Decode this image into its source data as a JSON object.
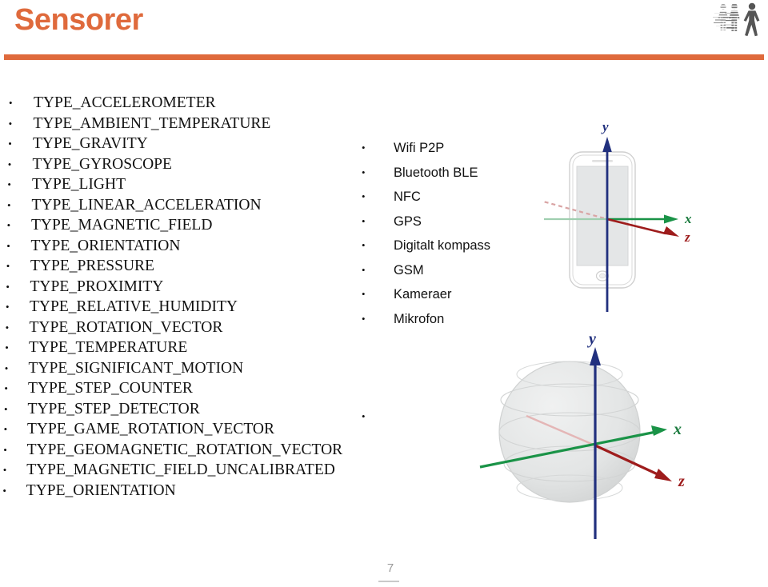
{
  "header": {
    "title": "Sensorer",
    "accent_color": "#DF6A3C",
    "rule_color": "#DF6A3C",
    "logo_name": "walking-people-logo"
  },
  "sensor_types": [
    "TYPE_ACCELEROMETER",
    "TYPE_AMBIENT_TEMPERATURE",
    "TYPE_GRAVITY",
    "TYPE_GYROSCOPE",
    "TYPE_LIGHT",
    "TYPE_LINEAR_ACCELERATION",
    "TYPE_MAGNETIC_FIELD",
    "TYPE_ORIENTATION",
    "TYPE_PRESSURE",
    "TYPE_PROXIMITY",
    "TYPE_RELATIVE_HUMIDITY",
    "TYPE_ROTATION_VECTOR",
    "TYPE_TEMPERATURE",
    "TYPE_SIGNIFICANT_MOTION",
    "TYPE_STEP_COUNTER",
    "TYPE_STEP_DETECTOR",
    "TYPE_GAME_ROTATION_VECTOR",
    "TYPE_GEOMAGNETIC_ROTATION_VECTOR",
    "TYPE_MAGNETIC_FIELD_UNCALIBRATED",
    "TYPE_ORIENTATION"
  ],
  "radios": [
    "Wifi P2P",
    "Bluetooth BLE",
    "NFC",
    "GPS",
    "Digitalt kompass",
    "GSM",
    "Kameraer",
    "Mikrofon"
  ],
  "figures": {
    "phone": {
      "name": "phone-axes-diagram",
      "axis_labels": {
        "y": "y",
        "x": "x",
        "z": "z"
      },
      "axis_colors": {
        "y": "#21307e",
        "x": "#1a9347",
        "z": "#9e1c1c"
      }
    },
    "globe": {
      "name": "globe-axes-diagram",
      "axis_labels": {
        "y": "y",
        "x": "x",
        "z": "z"
      },
      "axis_colors": {
        "y": "#21307e",
        "x": "#1a9347",
        "z": "#9e1c1c"
      }
    }
  },
  "footer": {
    "page_number": "7"
  }
}
